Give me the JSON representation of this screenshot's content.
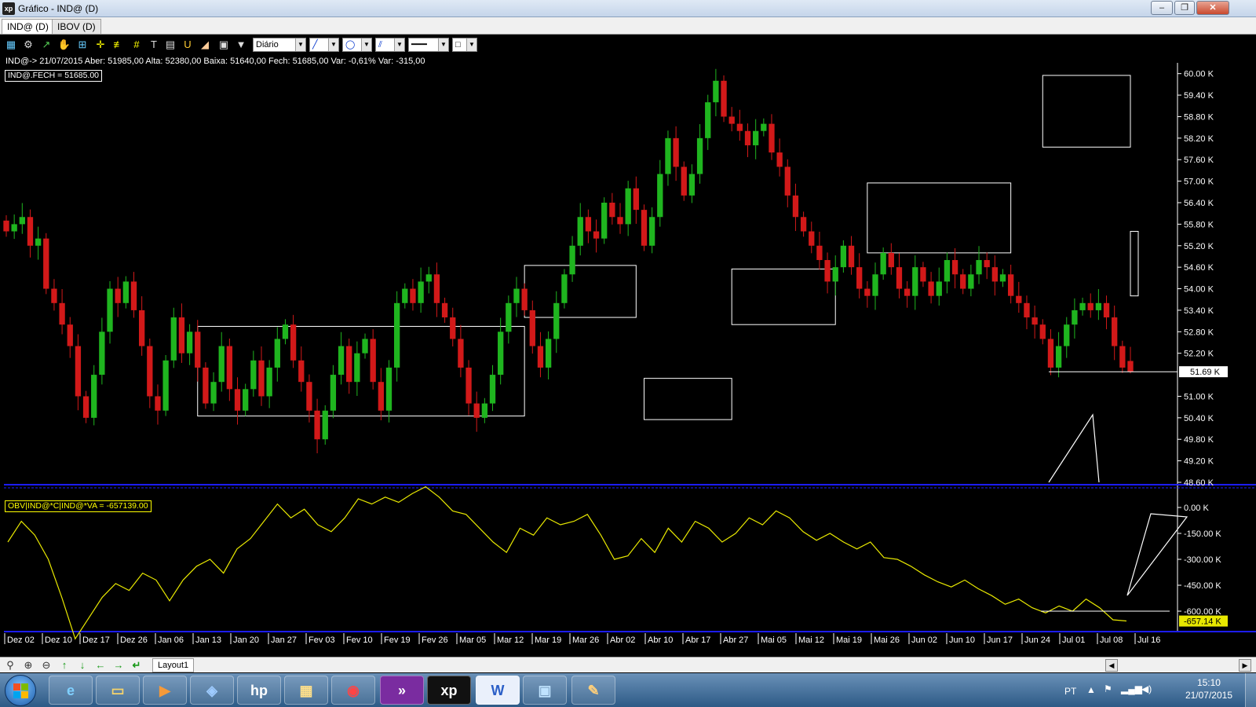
{
  "window": {
    "title": "Gráfico - IND@ (D)",
    "logo": "xp",
    "min": "–",
    "max": "❐",
    "close": "✕"
  },
  "tabs": [
    {
      "label": "IND@ (D)"
    },
    {
      "label": "IBOV (D)"
    }
  ],
  "toolbar": {
    "period": "Diário"
  },
  "info_line": "IND@-> 21/07/2015 Aber: 51985,00 Alta: 52380,00 Baixa: 51640,00 Fech: 51685,00 Var: -0,61% Var: -315,00",
  "main_legend": "IND@.FECH = 51685.00",
  "osc_legend": "OBV|IND@*C|IND@*VA = -657139.00",
  "price_badge": "51.69 K",
  "obv_badge": "-657.14 K",
  "bottom": {
    "layout_tab": "Layout1"
  },
  "taskbar": {
    "lang": "PT",
    "time": "15:10",
    "date": "21/07/2015"
  },
  "colors": {
    "up": "#1fb51f",
    "down": "#d21919",
    "obv": "#e8e800",
    "axis": "#ffffff",
    "separator": "#1c1cff"
  },
  "chart_data": [
    {
      "type": "candlestick",
      "y_ticks": [
        "60.00 K",
        "59.40 K",
        "58.80 K",
        "58.20 K",
        "57.60 K",
        "57.00 K",
        "56.40 K",
        "55.80 K",
        "55.20 K",
        "54.60 K",
        "54.00 K",
        "53.40 K",
        "52.80 K",
        "52.20 K",
        "51.00 K",
        "50.40 K",
        "49.80 K",
        "49.20 K",
        "48.60 K"
      ],
      "ylim": [
        48.6,
        60.3
      ],
      "x_ticks": [
        "Dez 02",
        "Dez 10",
        "Dez 17",
        "Dez 26",
        "Jan 06",
        "Jan 13",
        "Jan 20",
        "Jan 27",
        "Fev 03",
        "Fev 10",
        "Fev 19",
        "Fev 26",
        "Mar 05",
        "Mar 12",
        "Mar 19",
        "Mar 26",
        "Abr 02",
        "Abr 10",
        "Abr 17",
        "Abr 27",
        "Mai 05",
        "Mai 12",
        "Mai 19",
        "Mai 26",
        "Jun 02",
        "Jun 10",
        "Jun 17",
        "Jun 24",
        "Jul 01",
        "Jul 08",
        "Jul 16"
      ],
      "close_series": [
        55.6,
        55.8,
        56.0,
        55.2,
        55.4,
        54.0,
        53.6,
        53.0,
        52.4,
        51.0,
        50.4,
        51.6,
        52.8,
        54.0,
        53.6,
        54.2,
        53.4,
        52.4,
        51.0,
        50.6,
        52.0,
        53.2,
        52.2,
        52.8,
        51.8,
        50.8,
        51.4,
        52.4,
        51.2,
        50.6,
        51.2,
        52.0,
        51.0,
        51.8,
        52.6,
        53.0,
        52.0,
        51.4,
        50.6,
        49.8,
        50.6,
        51.6,
        52.4,
        51.4,
        52.2,
        52.6,
        51.4,
        50.6,
        51.8,
        53.6,
        54.0,
        53.6,
        54.2,
        54.4,
        53.6,
        53.2,
        52.6,
        51.8,
        50.8,
        50.4,
        50.8,
        51.6,
        52.8,
        53.6,
        54.0,
        53.4,
        52.4,
        51.8,
        52.6,
        53.6,
        54.4,
        55.2,
        56.0,
        55.6,
        55.4,
        56.4,
        56.0,
        55.8,
        56.8,
        56.2,
        55.2,
        56.0,
        57.2,
        58.2,
        57.4,
        56.6,
        57.2,
        58.2,
        59.2,
        59.8,
        58.8,
        58.6,
        58.4,
        58.0,
        58.4,
        58.6,
        57.8,
        57.4,
        56.6,
        56.0,
        55.6,
        55.2,
        54.8,
        54.2,
        54.6,
        55.2,
        54.6,
        54.0,
        53.8,
        54.4,
        55.0,
        54.6,
        54.0,
        53.8,
        54.6,
        54.2,
        53.8,
        54.2,
        54.8,
        54.4,
        54.0,
        54.4,
        54.8,
        54.6,
        54.2,
        54.4,
        53.8,
        53.6,
        53.2,
        53.0,
        52.6,
        51.8,
        52.4,
        53.0,
        53.4,
        53.6,
        53.4,
        53.6,
        53.2,
        52.4,
        51.8,
        51.7
      ],
      "close": 51.685,
      "open": 51.985,
      "high": 52.38,
      "low": 51.64
    },
    {
      "type": "line",
      "series": [
        {
          "name": "OBV|IND@*C|IND@*VA",
          "values": [
            -200,
            -80,
            -160,
            -300,
            -520,
            -760,
            -640,
            -520,
            -440,
            -480,
            -380,
            -420,
            -540,
            -420,
            -340,
            -300,
            -380,
            -240,
            -180,
            -80,
            20,
            -60,
            -10,
            -100,
            -140,
            -60,
            50,
            20,
            60,
            30,
            80,
            120,
            60,
            -20,
            -40,
            -120,
            -200,
            -260,
            -120,
            -160,
            -60,
            -100,
            -80,
            -40,
            -160,
            -300,
            -280,
            -180,
            -260,
            -120,
            -200,
            -80,
            -120,
            -200,
            -150,
            -60,
            -100,
            -20,
            -60,
            -140,
            -190,
            -150,
            -200,
            -240,
            -200,
            -290,
            -300,
            -340,
            -390,
            -430,
            -460,
            -420,
            -470,
            -510,
            -560,
            -530,
            -580,
            -610,
            -570,
            -600,
            -530,
            -580,
            -650,
            -657
          ]
        }
      ],
      "y_ticks": [
        "0.00 K",
        "-150.00 K",
        "-300.00 K",
        "-450.00 K",
        "-600.00 K"
      ],
      "ylim": [
        -700,
        100
      ],
      "last": -657.14
    }
  ]
}
